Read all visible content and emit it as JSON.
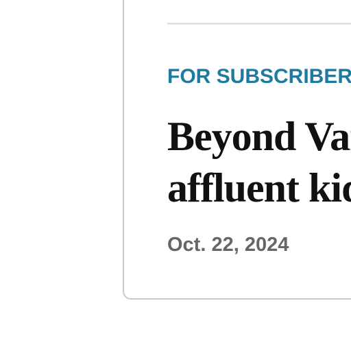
{
  "article_card": {
    "label": "FOR SUBSCRIBERS",
    "headline_lines": [
      "Beyond Van",
      "affluent kid"
    ],
    "date": "Oct. 22, 2024"
  }
}
